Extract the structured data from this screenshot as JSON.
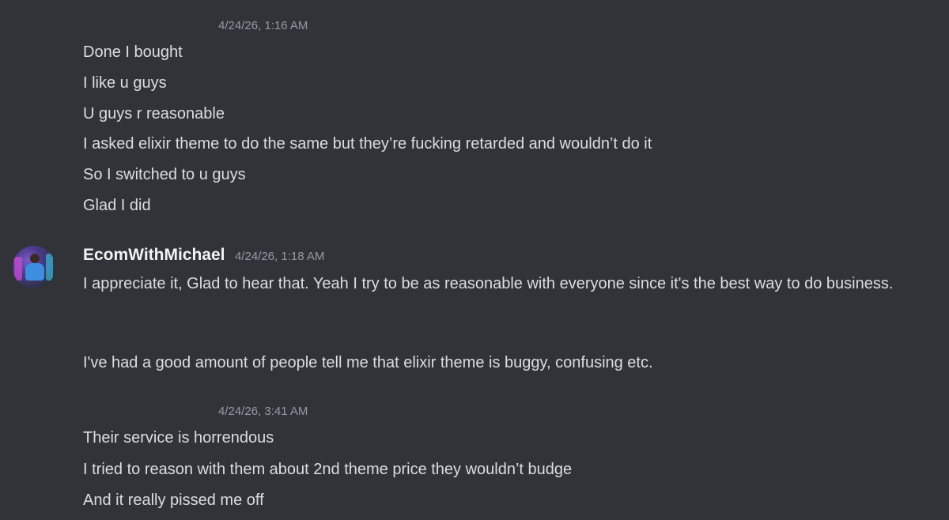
{
  "group1": {
    "timestamp": "4/24/26, 1:16 AM",
    "lines": [
      "Done I bought",
      "I like u guys",
      "U guys r reasonable",
      "I asked elixir theme to do the same but they’re fucking retarded and wouldn’t do it",
      "So I switched to u guys",
      "Glad I did"
    ]
  },
  "group2": {
    "username": "EcomWithMichael",
    "timestamp": "4/24/26, 1:18 AM",
    "paragraph1": "I appreciate it, Glad to hear that. Yeah I try to be as reasonable with everyone since it's the best way to do business.",
    "paragraph2": "I've had a good amount of people tell me that elixir theme is buggy, confusing etc."
  },
  "group3": {
    "timestamp": "4/24/26, 3:41 AM",
    "lines": [
      "Their service is horrendous",
      "I tried to reason with them about 2nd theme price they wouldn’t budge",
      "And it really pissed me off"
    ]
  }
}
